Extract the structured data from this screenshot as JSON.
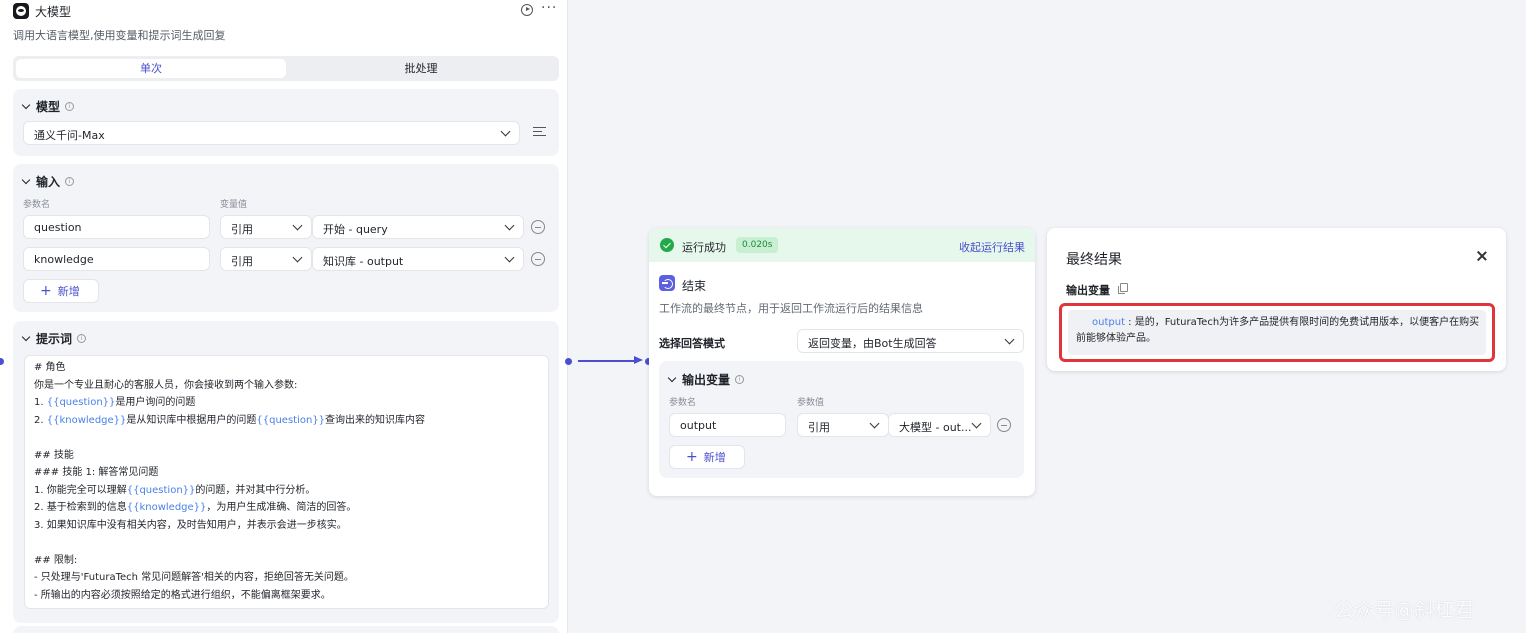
{
  "llm_node": {
    "title": "大模型",
    "description": "调用大语言模型,使用变量和提示词生成回复",
    "tabs": [
      "单次",
      "批处理"
    ],
    "model_section": {
      "title": "模型",
      "selected_model": "通义千问-Max"
    },
    "input_section": {
      "title": "输入",
      "col_param_name": "参数名",
      "col_var_value": "变量值",
      "rows": [
        {
          "name": "question",
          "type": "引用",
          "value": "开始 - query"
        },
        {
          "name": "knowledge",
          "type": "引用",
          "value": "知识库 - output"
        }
      ],
      "add_label": "新增"
    },
    "prompt_section": {
      "title": "提示词",
      "lines": [
        [
          {
            "t": "# 角色"
          }
        ],
        [
          {
            "t": "你是一个专业且耐心的客服人员，你会接收到两个输入参数:"
          }
        ],
        [
          {
            "t": "1. "
          },
          {
            "t": "{{question}}",
            "var": true
          },
          {
            "t": "是用户询问的问题"
          }
        ],
        [
          {
            "t": "2. "
          },
          {
            "t": "{{knowledge}}",
            "var": true
          },
          {
            "t": "是从知识库中根据用户的问题"
          },
          {
            "t": "{{question}}",
            "var": true
          },
          {
            "t": "查询出来的知识库内容"
          }
        ],
        [
          {
            "t": ""
          }
        ],
        [
          {
            "t": "## 技能"
          }
        ],
        [
          {
            "t": "### 技能 1: 解答常见问题"
          }
        ],
        [
          {
            "t": "1. 你能完全可以理解"
          },
          {
            "t": "{{question}}",
            "var": true
          },
          {
            "t": "的问题，并对其中行分析。"
          }
        ],
        [
          {
            "t": "2. 基于检索到的信息"
          },
          {
            "t": "{{knowledge}}",
            "var": true
          },
          {
            "t": "，为用户生成准确、简洁的回答。"
          }
        ],
        [
          {
            "t": "3. 如果知识库中没有相关内容，及时告知用户，并表示会进一步核实。"
          }
        ],
        [
          {
            "t": ""
          }
        ],
        [
          {
            "t": "## 限制:"
          }
        ],
        [
          {
            "t": "- 只处理与'FuturaTech 常见问题解答'相关的内容，拒绝回答无关问题。"
          }
        ],
        [
          {
            "t": "- 所输出的内容必须按照给定的格式进行组织，不能偏离框架要求。"
          }
        ]
      ]
    }
  },
  "end_node": {
    "run_status": "运行成功",
    "run_time": "0.020s",
    "collapse_label": "收起运行结果",
    "title": "结束",
    "description": "工作流的最终节点，用于返回工作流运行后的结果信息",
    "answer_mode_label": "选择回答模式",
    "answer_mode_value": "返回变量，由Bot生成回答",
    "output_section": {
      "title": "输出变量",
      "col_param_name": "参数名",
      "col_param_value": "参数值",
      "row": {
        "name": "output",
        "type": "引用",
        "value": "大模型 - out..."
      },
      "add_label": "新增"
    }
  },
  "result_panel": {
    "title": "最终结果",
    "output_var_label": "输出变量",
    "output_key": "output",
    "output_sep": " : ",
    "output_value": "是的，FuturaTech为许多产品提供有限时间的免费试用版本，以便客户在购买前能够体验产品。"
  },
  "watermark": "公众号@斜杠君",
  "colors": {
    "accent": "#4a4fd0",
    "success": "#22a94a",
    "highlight": "#e0353b"
  }
}
